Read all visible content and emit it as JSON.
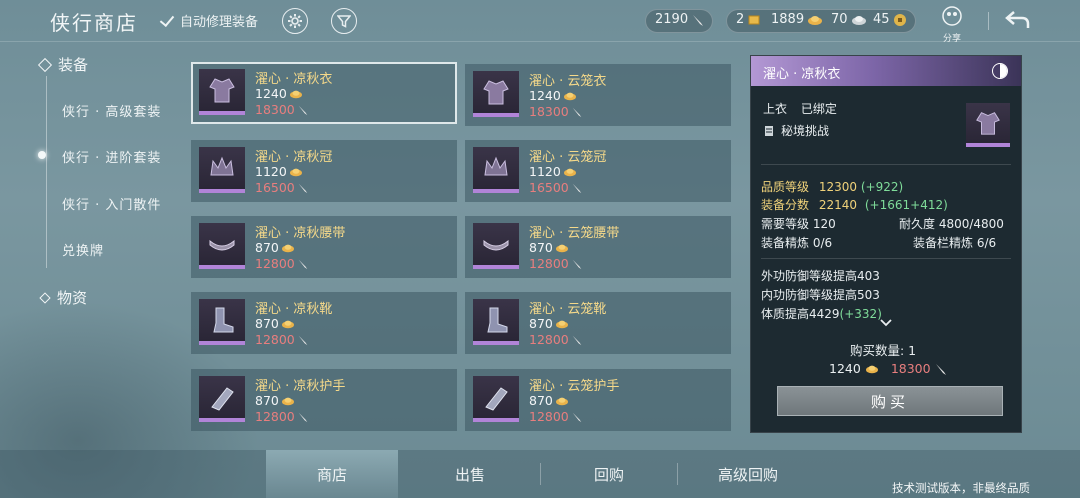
{
  "header": {
    "title": "侠行商店",
    "auto_repair_label": "自动修理装备",
    "currencies": {
      "c1": "2190",
      "c2": "2",
      "c3": "1889",
      "c4": "70",
      "c5": "45"
    },
    "share_label": "分享"
  },
  "nav": {
    "category_equip": "装备",
    "items": [
      {
        "label": "侠行 · 高级套装"
      },
      {
        "label": "侠行 · 进阶套装"
      },
      {
        "label": "侠行 · 入门散件"
      },
      {
        "label": "兑换牌"
      }
    ],
    "category_goods": "物资"
  },
  "items": [
    {
      "name": "濯心 · 凉秋衣",
      "price_a": "1240",
      "price_b": "18300"
    },
    {
      "name": "濯心 · 云笼衣",
      "price_a": "1240",
      "price_b": "18300"
    },
    {
      "name": "濯心 · 凉秋冠",
      "price_a": "1120",
      "price_b": "16500"
    },
    {
      "name": "濯心 · 云笼冠",
      "price_a": "1120",
      "price_b": "16500"
    },
    {
      "name": "濯心 · 凉秋腰带",
      "price_a": "870",
      "price_b": "12800"
    },
    {
      "name": "濯心 · 云笼腰带",
      "price_a": "870",
      "price_b": "12800"
    },
    {
      "name": "濯心 · 凉秋靴",
      "price_a": "870",
      "price_b": "12800"
    },
    {
      "name": "濯心 · 云笼靴",
      "price_a": "870",
      "price_b": "12800"
    },
    {
      "name": "濯心 · 凉秋护手",
      "price_a": "870",
      "price_b": "12800"
    },
    {
      "name": "濯心 · 云笼护手",
      "price_a": "870",
      "price_b": "12800"
    }
  ],
  "detail": {
    "title": "濯心 · 凉秋衣",
    "slot": "上衣",
    "bound": "已绑定",
    "source": "秘境挑战",
    "quality_label": "品质等级",
    "quality_value": "12300",
    "quality_bonus": "(+922)",
    "score_label": "装备分数",
    "score_value": "22140",
    "score_bonus": "(+1661+412)",
    "req_level": "需要等级 120",
    "durability": "耐久度 4800/4800",
    "refine": "装备精炼 0/6",
    "slot_refine": "装备栏精炼 6/6",
    "stat1": "外功防御等级提高403",
    "stat2": "内功防御等级提高503",
    "stat3_main": "体质提高4429",
    "stat3_bonus": "(+332)",
    "qty_label": "购买数量: 1",
    "cost_a": "1240",
    "cost_b": "18300",
    "buy_label": "购买"
  },
  "tabs": [
    {
      "label": "商店"
    },
    {
      "label": "出售"
    },
    {
      "label": "回购"
    },
    {
      "label": "高级回购"
    }
  ],
  "notice": "技术测试版本，非最终品质",
  "colors": {
    "accent_purple": "#b184d8",
    "gold_text": "#f5d98a",
    "red_price": "#e87e7e",
    "green_bonus": "#7fdc9a"
  }
}
